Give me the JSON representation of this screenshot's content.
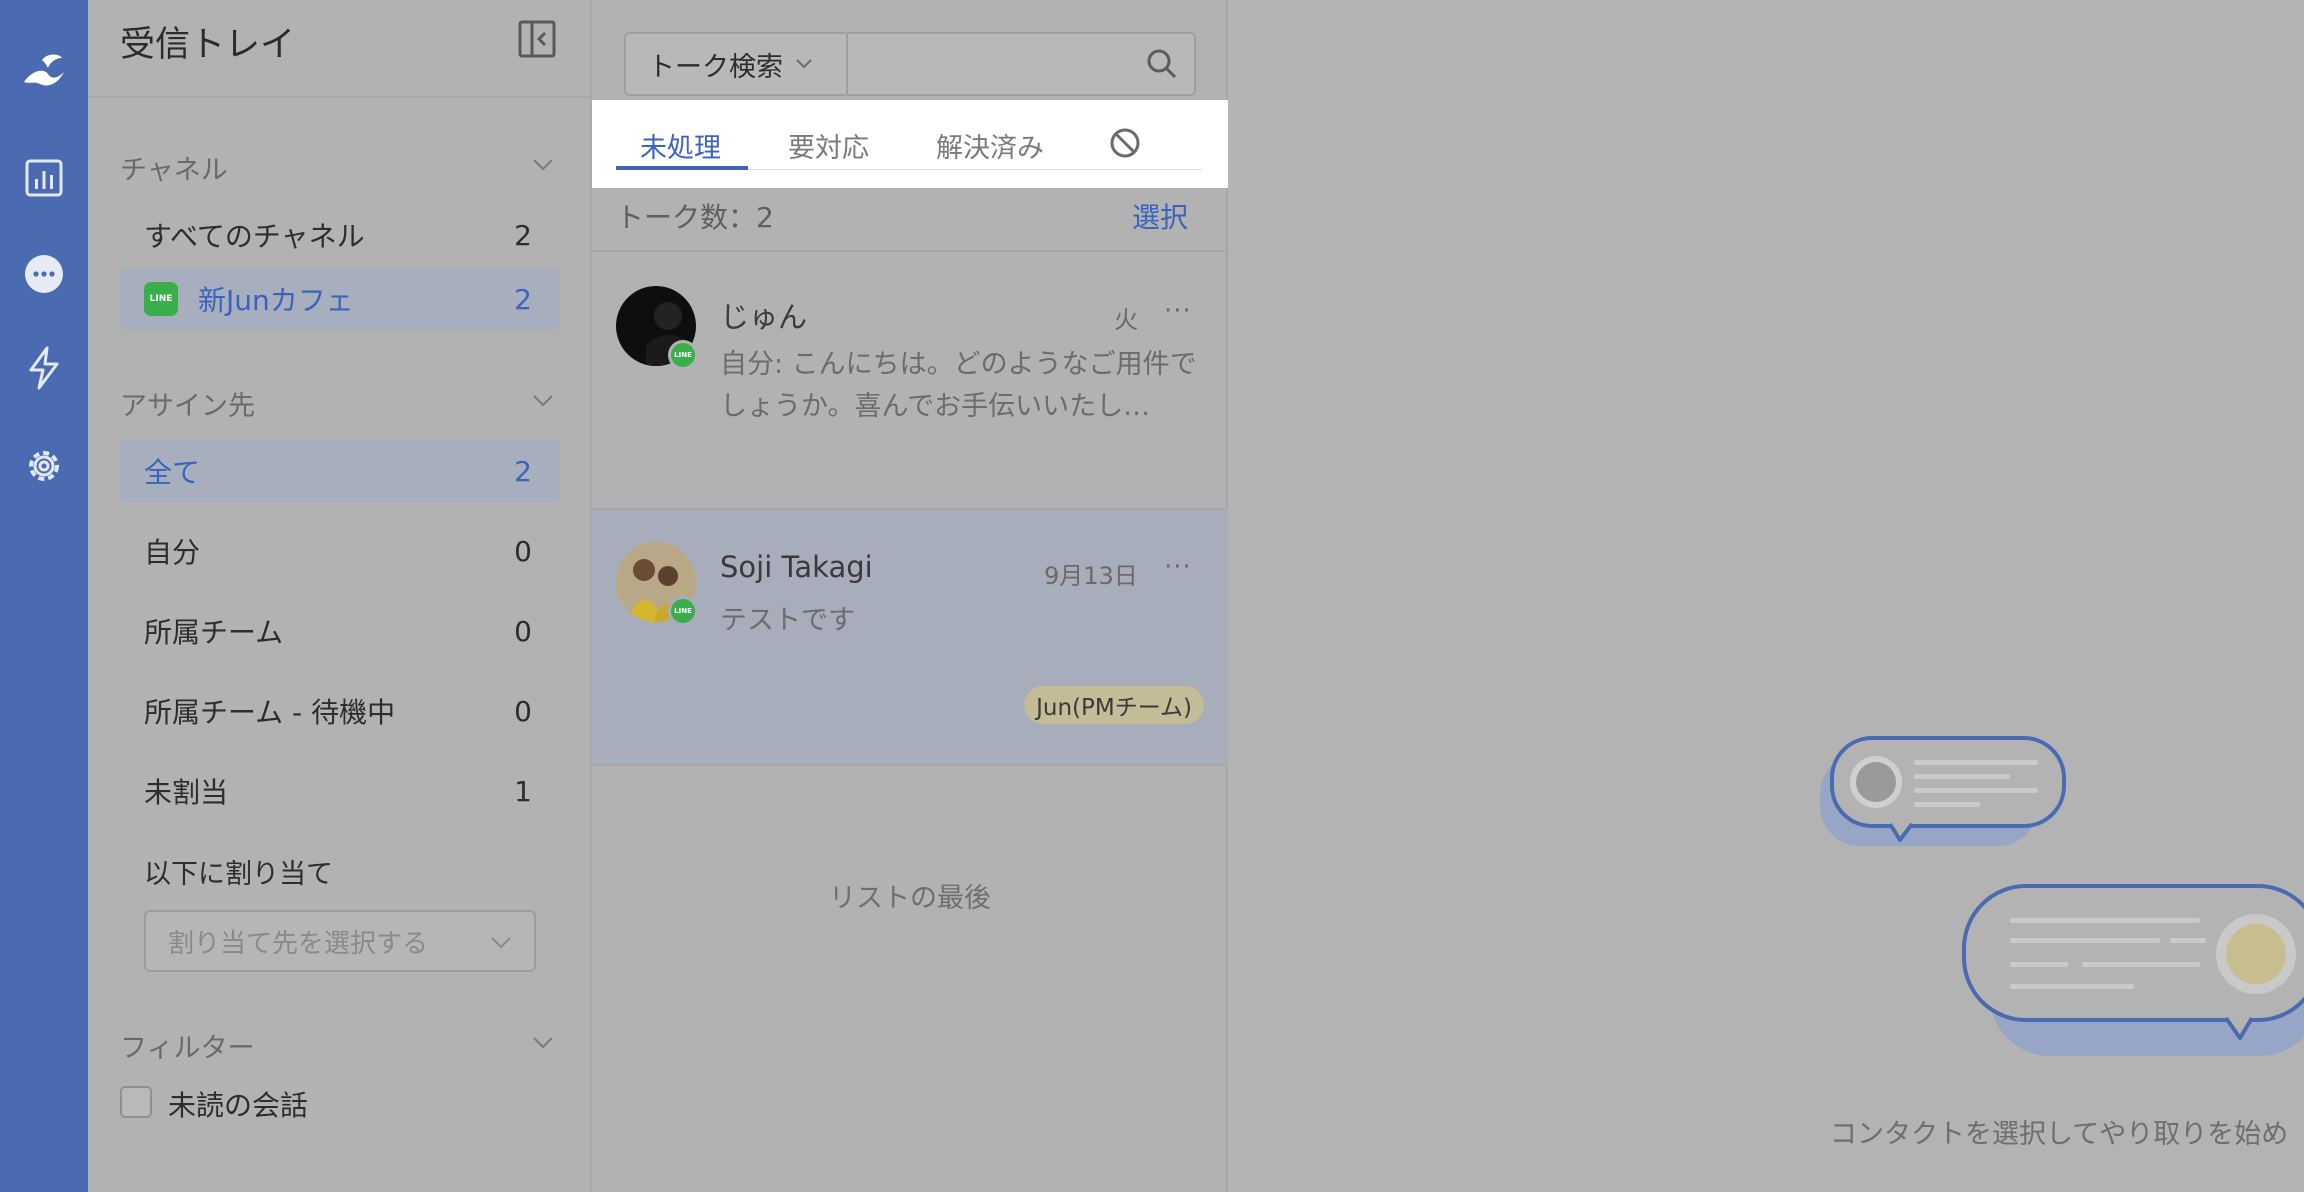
{
  "sidebar": {
    "title": "受信トレイ",
    "channels": {
      "heading": "チャネル",
      "items": [
        {
          "label": "すべてのチャネル",
          "count": "2"
        },
        {
          "label": "新Junカフェ",
          "count": "2",
          "badge": "LINE"
        }
      ]
    },
    "assignees": {
      "heading": "アサイン先",
      "items": [
        {
          "label": "全て",
          "count": "2"
        },
        {
          "label": "自分",
          "count": "0"
        },
        {
          "label": "所属チーム",
          "count": "0"
        },
        {
          "label": "所属チーム - 待機中",
          "count": "0"
        },
        {
          "label": "未割当",
          "count": "1"
        }
      ],
      "assign_label": "以下に割り当て",
      "assign_placeholder": "割り当て先を選択する"
    },
    "filter": {
      "heading": "フィルター",
      "unread_label": "未読の会話"
    }
  },
  "list": {
    "search": {
      "type_label": "トーク検索",
      "value": ""
    },
    "tabs": [
      {
        "label": "未処理"
      },
      {
        "label": "要対応"
      },
      {
        "label": "解決済み"
      }
    ],
    "count_text": "トーク数：2",
    "select_label": "選択",
    "conversations": [
      {
        "name": "じゅん",
        "time": "火",
        "preview": "自分: こんにちは。どのようなご用件でしょうか。喜んでお手伝いいたし…",
        "badge": "LINE"
      },
      {
        "name": "Soji Takagi",
        "time": "9月13日",
        "preview": "テストです",
        "tag": "Jun(PMチーム)",
        "badge": "LINE"
      }
    ],
    "list_end": "リストの最後"
  },
  "main": {
    "empty_text": "コンタクトを選択してやり取りを始め"
  },
  "colors": {
    "rail": "#4a6bb1",
    "accent": "#3b63bd",
    "line_green": "#3bae4c",
    "tag": "#c4bc97"
  }
}
